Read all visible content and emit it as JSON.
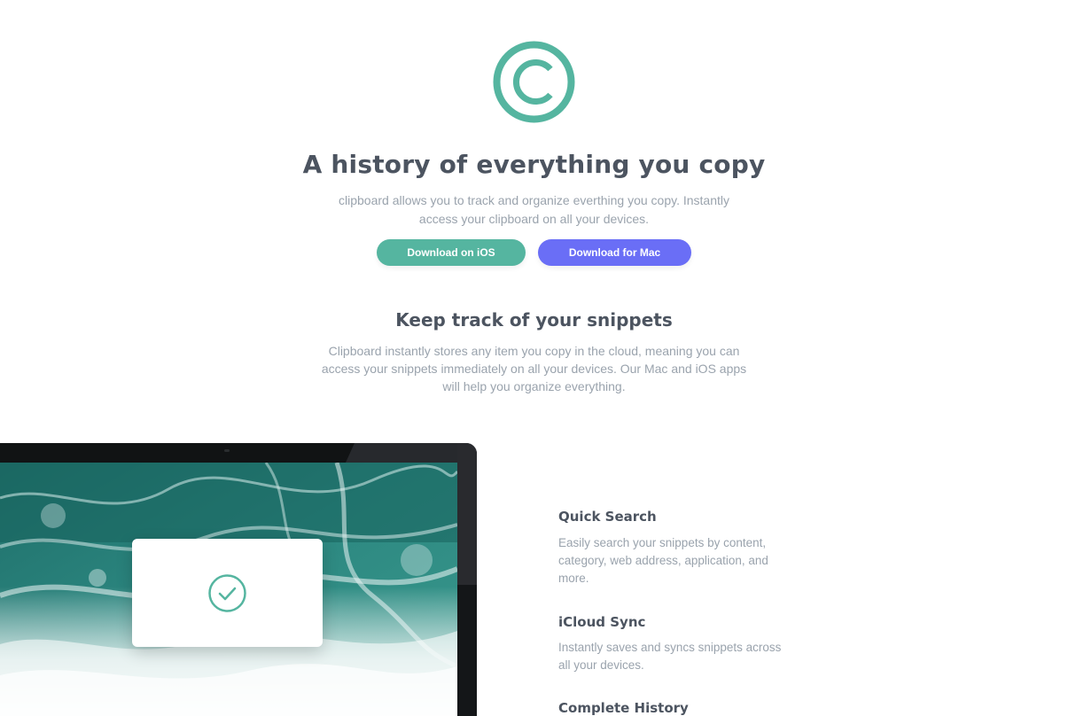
{
  "hero": {
    "title": "A history of everything you copy",
    "description": "clipboard allows you to track and organize everthing you copy. Instantly access your clipboard on all your devices.",
    "buttons": {
      "ios_label": "Download on iOS",
      "mac_label": "Download for Mac"
    }
  },
  "snippets": {
    "title": "Keep track of your snippets",
    "description": "Clipboard instantly stores any item you copy in the cloud, meaning you can access your snippets immediately on all your devices. Our Mac and iOS apps will help you organize everything."
  },
  "features": [
    {
      "title": "Quick Search",
      "description": "Easily search your snippets by content, category, web address, application, and more."
    },
    {
      "title": "iCloud Sync",
      "description": "Instantly saves and syncs snippets across all your devices."
    },
    {
      "title": "Complete History",
      "description": ""
    }
  ],
  "icons": {
    "logo": "copyright-logo-icon",
    "check": "checkmark-circle-icon"
  },
  "colors": {
    "accent_teal": "#55b5a0",
    "accent_violet": "#6a6ef6",
    "heading": "#4c5460",
    "body": "#9aa3ad",
    "device_frame": "#111314"
  }
}
